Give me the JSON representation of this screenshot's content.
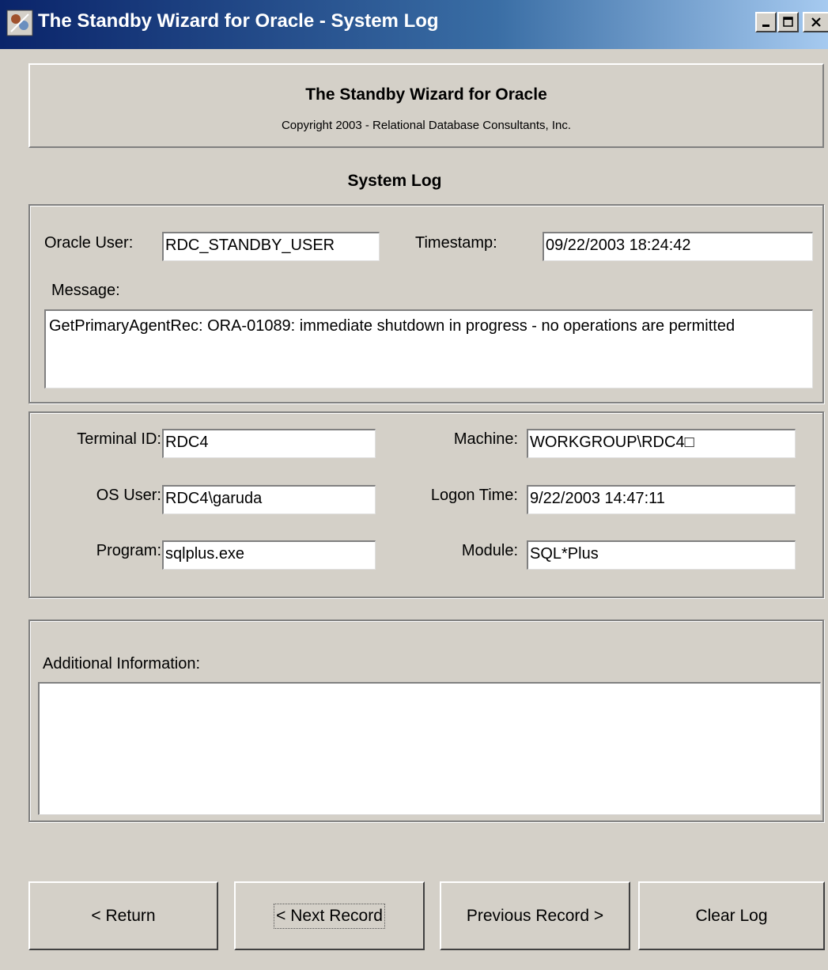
{
  "window": {
    "title": "The Standby Wizard for Oracle - System Log",
    "icon": "app-icon",
    "controls": [
      "minimize-icon",
      "maximize-icon",
      "close-icon"
    ]
  },
  "header": {
    "app_title": "The Standby Wizard for Oracle",
    "copyright": "Copyright 2003 - Relational Database Consultants, Inc."
  },
  "section_title": "System Log",
  "log": {
    "oracle_user_label": "Oracle User:",
    "oracle_user": "RDC_STANDBY_USER",
    "timestamp_label": "Timestamp:",
    "timestamp": "09/22/2003 18:24:42",
    "message_label": "Message:",
    "message": "GetPrimaryAgentRec: ORA-01089: immediate shutdown in progress - no operations are permitted"
  },
  "session": {
    "terminal_id_label": "Terminal ID:",
    "terminal_id": "RDC4",
    "machine_label": "Machine:",
    "machine": "WORKGROUP\\RDC4□",
    "os_user_label": "OS User:",
    "os_user": "RDC4\\garuda",
    "logon_time_label": "Logon Time:",
    "logon_time": "9/22/2003 14:47:11",
    "program_label": "Program:",
    "program": "sqlplus.exe",
    "module_label": "Module:",
    "module": "SQL*Plus"
  },
  "additional": {
    "label": "Additional Information:",
    "value": ""
  },
  "buttons": {
    "return": "< Return",
    "next": "< Next Record",
    "previous": "Previous Record >",
    "clear": "Clear Log"
  }
}
